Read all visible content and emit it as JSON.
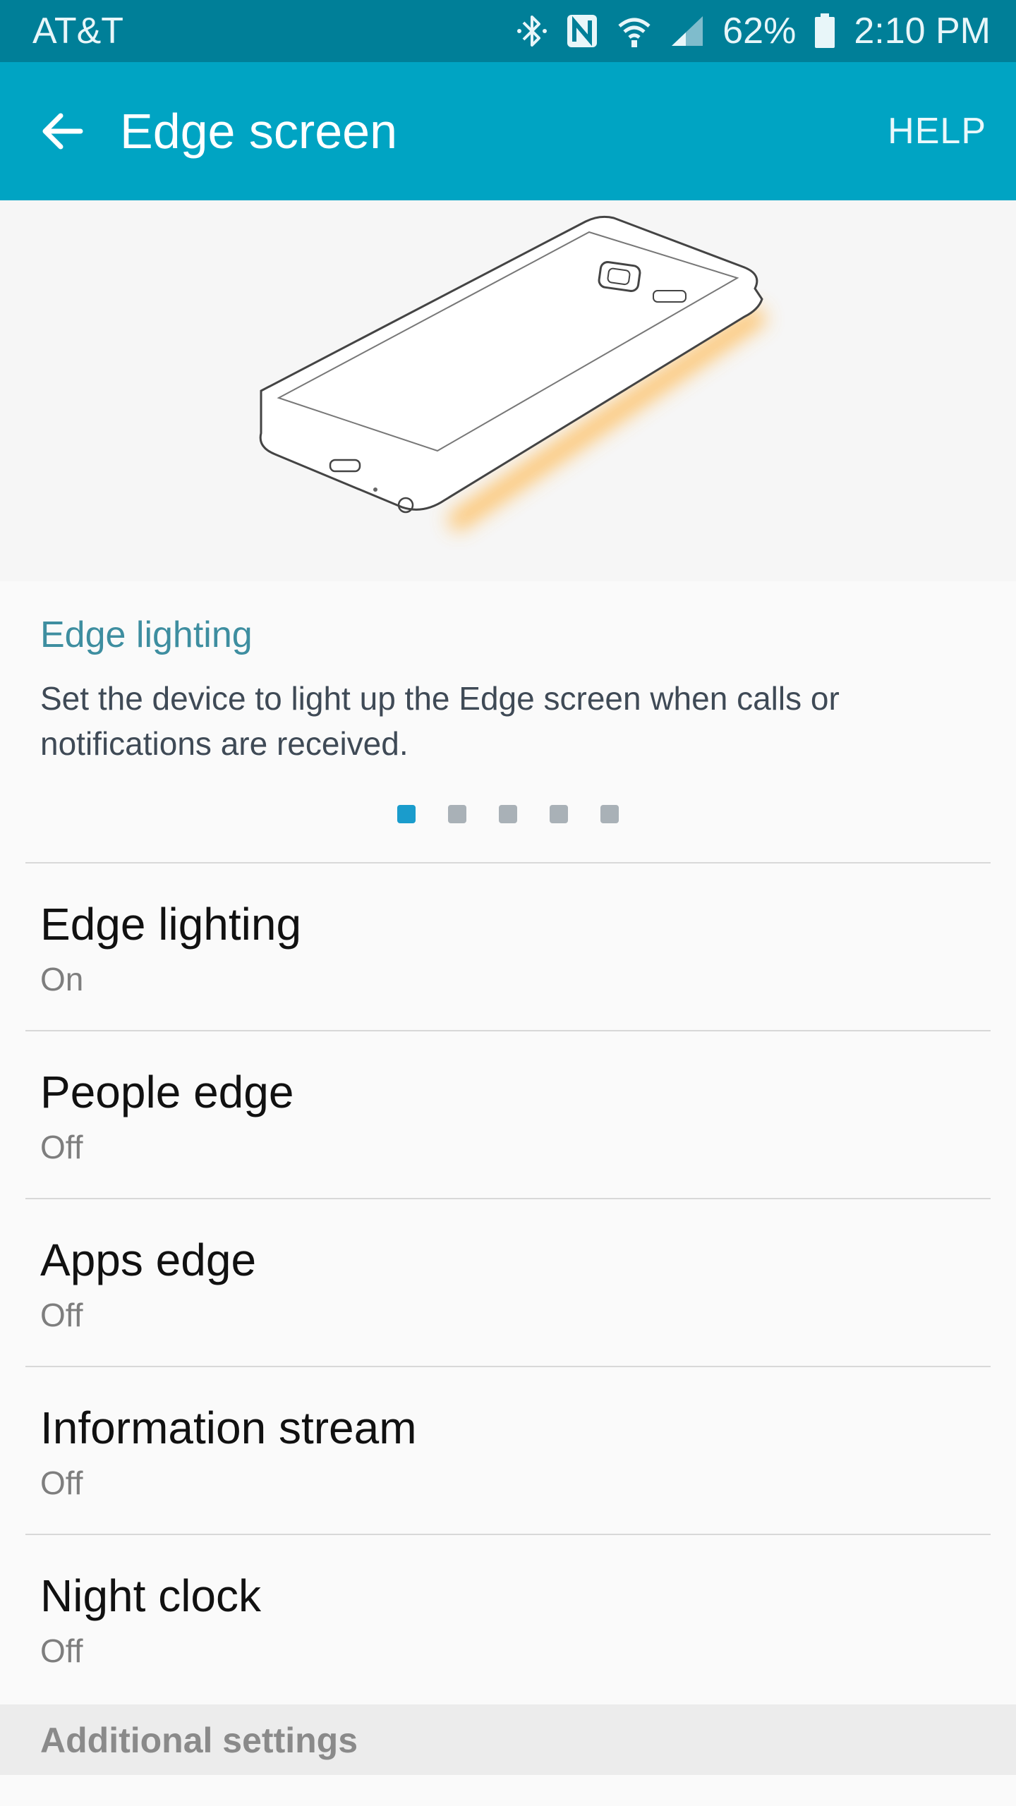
{
  "status_bar": {
    "carrier": "AT&T",
    "battery": "62%",
    "time": "2:10 PM",
    "icons": [
      "bluetooth-icon",
      "nfc-icon",
      "wifi-icon",
      "signal-icon",
      "battery-icon"
    ]
  },
  "app_bar": {
    "title": "Edge screen",
    "help_label": "HELP",
    "back_icon": "back-arrow-icon"
  },
  "info": {
    "title": "Edge lighting",
    "description": "Set the device to light up the Edge screen when calls or notifications are received.",
    "pages_total": 5,
    "active_page": 1
  },
  "settings": [
    {
      "title": "Edge lighting",
      "value": "On"
    },
    {
      "title": "People edge",
      "value": "Off"
    },
    {
      "title": "Apps edge",
      "value": "Off"
    },
    {
      "title": "Information stream",
      "value": "Off"
    },
    {
      "title": "Night clock",
      "value": "Off"
    }
  ],
  "section_header": "Additional settings",
  "colors": {
    "status_bar": "#007f98",
    "app_bar": "#00a4c3",
    "accent": "#3e8ea0",
    "pager_active": "#1a9ccc",
    "edge_glow": "#ffb84d"
  }
}
